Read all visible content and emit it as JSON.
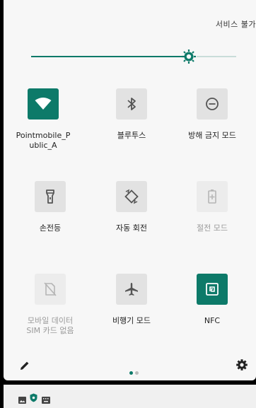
{
  "status": {
    "text": "서비스 불가"
  },
  "brightness": {
    "level": 0.77
  },
  "tiles": [
    {
      "label": "Pointmobile_Public_A",
      "icon": "wifi-icon",
      "state": "on"
    },
    {
      "label": "블루투스",
      "icon": "bluetooth-icon",
      "state": "off"
    },
    {
      "label": "방해 금지 모드",
      "icon": "do-not-disturb-icon",
      "state": "off"
    },
    {
      "label": "손전등",
      "icon": "flashlight-icon",
      "state": "off"
    },
    {
      "label": "자동 회전",
      "icon": "auto-rotate-icon",
      "state": "off"
    },
    {
      "label": "절전 모드",
      "icon": "battery-saver-icon",
      "state": "disabled"
    },
    {
      "label": "모바일 데이터\nSIM 카드 없음",
      "icon": "mobile-data-icon",
      "state": "disabled"
    },
    {
      "label": "비행기 모드",
      "icon": "airplane-icon",
      "state": "off"
    },
    {
      "label": "NFC",
      "icon": "nfc-icon",
      "state": "on"
    }
  ],
  "page_indicator": {
    "pages": 2,
    "current": 1
  },
  "colors": {
    "accent": "#0d7a69",
    "icon_off": "#555555",
    "icon_disabled": "#b5b5b5"
  }
}
